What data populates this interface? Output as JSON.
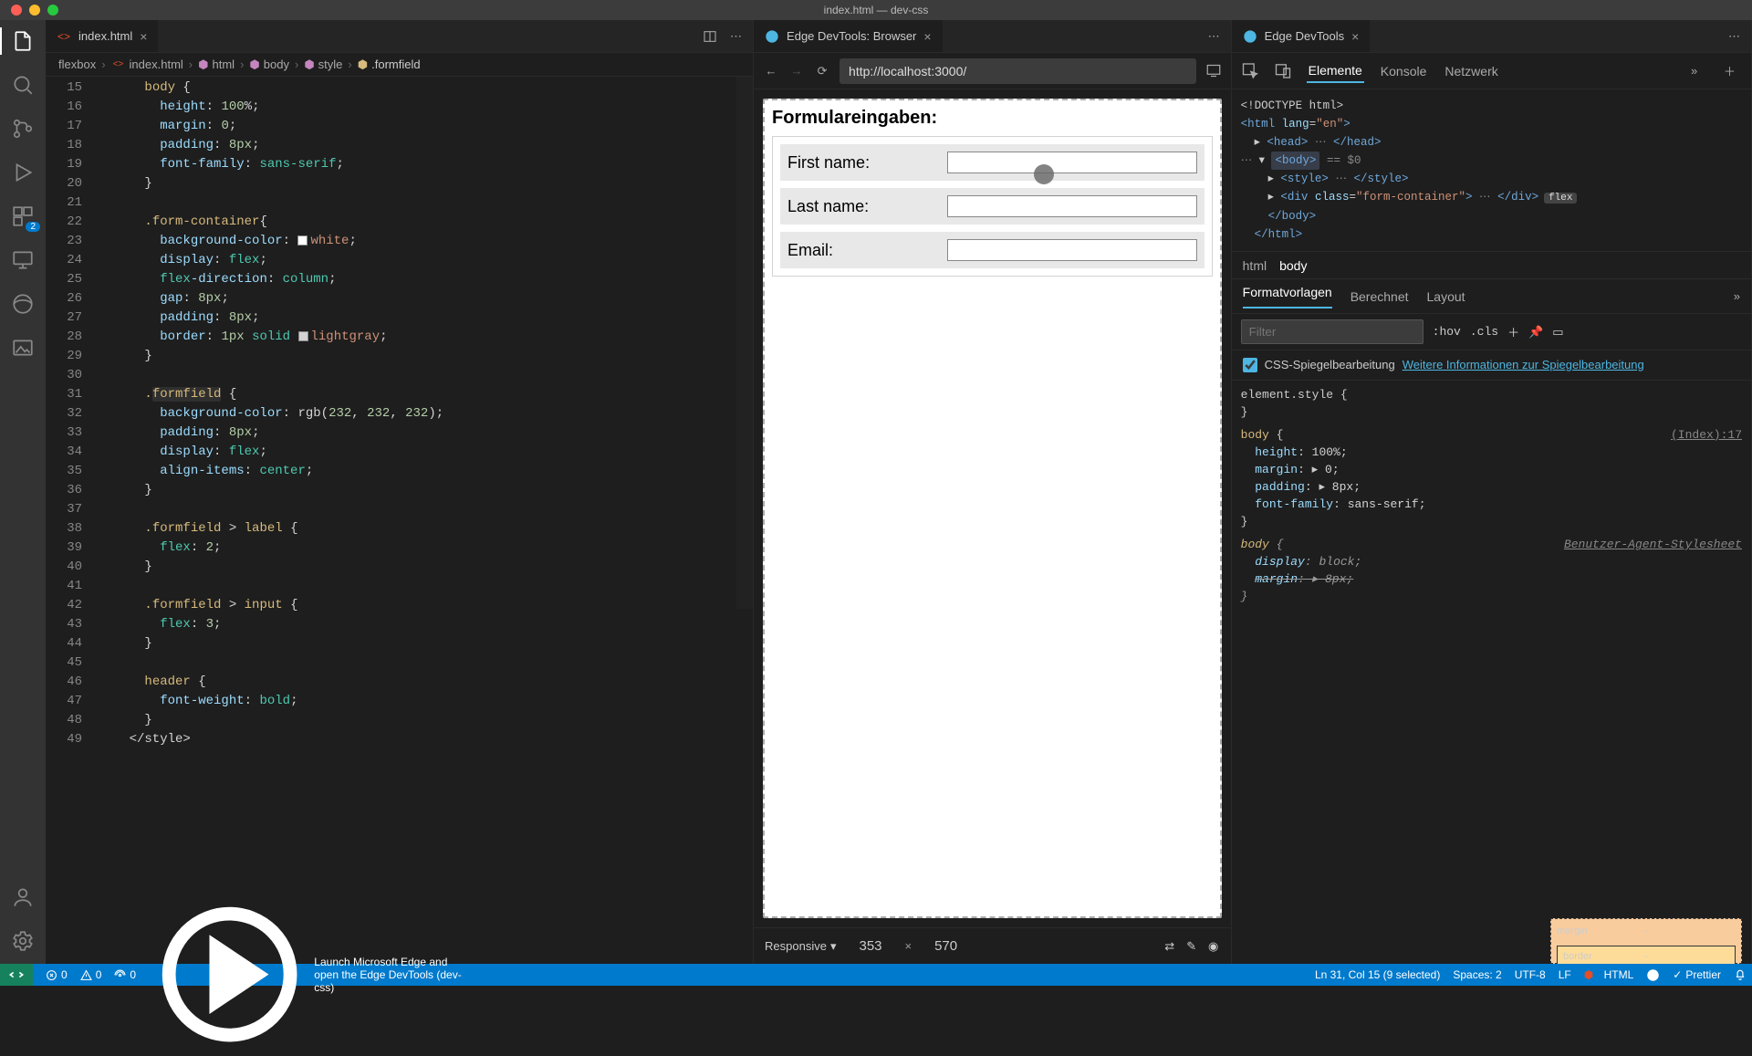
{
  "window": {
    "title": "index.html — dev-css"
  },
  "editor": {
    "tab": {
      "filename": "index.html"
    },
    "breadcrumb": [
      "flexbox",
      "index.html",
      "html",
      "body",
      "style",
      ".formfield"
    ],
    "lines_start": 15,
    "lines": [
      "      body {",
      "        height: 100%;",
      "        margin: 0;",
      "        padding: 8px;",
      "        font-family: sans-serif;",
      "      }",
      "",
      "      .form-container{",
      "        background-color: white;",
      "        display: flex;",
      "        flex-direction: column;",
      "        gap: 8px;",
      "        padding: 8px;",
      "        border: 1px solid lightgray;",
      "      }",
      "",
      "      .formfield {",
      "        background-color: rgb(232, 232, 232);",
      "        padding: 8px;",
      "        display: flex;",
      "        align-items: center;",
      "      }",
      "",
      "      .formfield > label {",
      "        flex: 2;",
      "      }",
      "",
      "      .formfield > input {",
      "        flex: 3;",
      "      }",
      "",
      "      header {",
      "        font-weight: bold;",
      "      }",
      "    </style>"
    ],
    "status": {
      "cursor": "Ln 31, Col 15 (9 selected)",
      "spaces": "Spaces: 2",
      "encoding": "UTF-8",
      "eol": "LF",
      "lang": "HTML",
      "prettier": "Prettier"
    }
  },
  "browser": {
    "tab": "Edge DevTools: Browser",
    "url": "http://localhost:3000/",
    "form": {
      "header": "Formulareingaben:",
      "fields": [
        {
          "label": "First name:"
        },
        {
          "label": "Last name:"
        },
        {
          "label": "Email:"
        }
      ]
    },
    "responsive_label": "Responsive",
    "width": "353",
    "height": "570"
  },
  "devtools": {
    "tab": "Edge DevTools",
    "panel_tabs": [
      "Elemente",
      "Konsole",
      "Netzwerk"
    ],
    "dom_breadcrumb": [
      "html",
      "body"
    ],
    "style_tabs": [
      "Formatvorlagen",
      "Berechnet",
      "Layout"
    ],
    "filter_placeholder": "Filter",
    "hov": ":hov",
    "cls": ".cls",
    "mirror_label": "CSS-Spiegelbearbeitung",
    "mirror_link": "Weitere Informationen zur Spiegelbearbeitung",
    "rules_src": "(Index):17",
    "ua_label": "Benutzer-Agent-Stylesheet",
    "box": {
      "margin": "margin",
      "border": "border",
      "dash": "-"
    }
  },
  "status_left": {
    "remote": "",
    "errors": "0",
    "warnings": "0",
    "port": "0",
    "launch": "Launch Microsoft Edge and open the Edge DevTools (dev-css)"
  },
  "activity_badge": "2"
}
